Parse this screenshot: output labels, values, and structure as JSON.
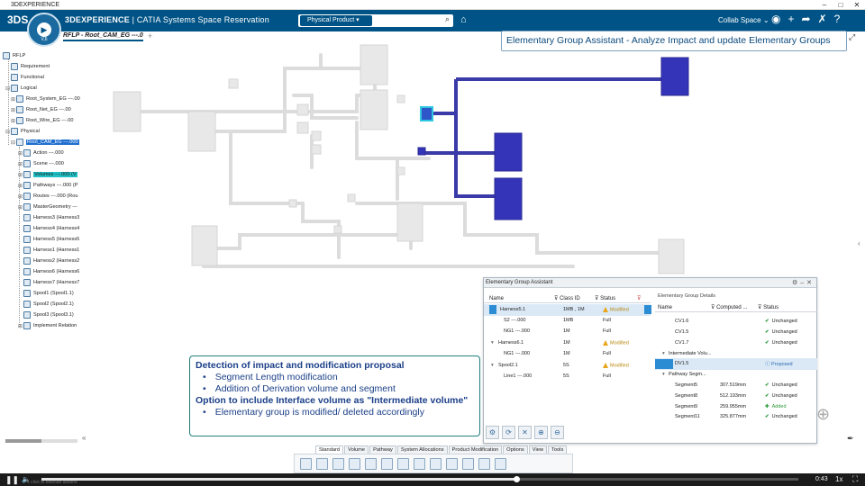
{
  "window": {
    "title": "3DEXPERIENCE"
  },
  "header": {
    "logo": "3DS",
    "brand_bold": "3DEXPERIENCE",
    "brand_rest": " | CATIA  Systems Space Reservation",
    "search_scope": "Physical Product",
    "collab_space": "Collab Space",
    "compass_version": "V,6"
  },
  "tab": {
    "label": "RFLP - Root_CAM_EG ---.0"
  },
  "banner": {
    "text": "Elementary Group Assistant - Analyze Impact and update Elementary Groups"
  },
  "tree": {
    "root": "RFLP",
    "requirement": "Requirement",
    "functional": "Functional",
    "logical": "Logical",
    "logical_items": [
      "Root_System_EG ---.00",
      "Root_Net_EG ---.00",
      "Root_Wire_EG ---.00"
    ],
    "physical": "Physical",
    "physical_root": "Root_CAM_EG ---.000",
    "children": [
      "Action ---.000",
      "Scene ---.000",
      "Volumes ---.000 (V",
      "Pathways ---.000 (P",
      "Routes ---.000 (Rou",
      "MasterGeometry ---"
    ],
    "harnesses": [
      "Harness3 (Harness3",
      "Harness4 (Harness4",
      "Harness5 (Harness5",
      "Harness1 (Harness1",
      "Harness2 (Harness2",
      "Harness6 (Harness6",
      "Harness7 (Harness7"
    ],
    "spools": [
      "Spool1 (Spool1.1)",
      "Spool2 (Spool2.1)",
      "Spool3 (Spool3.1)"
    ],
    "last": "Implement Relation"
  },
  "assistant": {
    "title": "Elementary Group Assistant",
    "left_headers": {
      "name": "Name",
      "class": "Class ID",
      "status": "Status"
    },
    "left_rows": [
      {
        "name": "Harness5.1",
        "class": "1MB , 1M",
        "status": "Modified",
        "warn": true
      },
      {
        "name": "S2 ---.000",
        "class": "1MB",
        "status": "Full",
        "warn": false
      },
      {
        "name": "NG1 ---.000",
        "class": "1M",
        "status": "Full",
        "warn": false
      },
      {
        "name": "Harness6.1",
        "class": "1M",
        "status": "Modified",
        "warn": true
      },
      {
        "name": "NG1 ---.000",
        "class": "1M",
        "status": "Full",
        "warn": false
      },
      {
        "name": "Spool2.1",
        "class": "5S",
        "status": "Modified",
        "warn": true
      },
      {
        "name": "Line1 ---.000",
        "class": "5S",
        "status": "Full",
        "warn": false
      }
    ],
    "details_title": "Elementary Group Details",
    "right_headers": {
      "name": "Name",
      "computed": "Computed ...",
      "status": "Status"
    },
    "right_rows": [
      {
        "name": "CV1.6",
        "computed": "",
        "status": "Unchanged"
      },
      {
        "name": "CV1.5",
        "computed": "",
        "status": "Unchanged"
      },
      {
        "name": "CV1.7",
        "computed": "",
        "status": "Unchanged"
      },
      {
        "name": "Intermediate Volu...",
        "computed": "",
        "status": ""
      },
      {
        "name": "DV1.5",
        "computed": "",
        "status": "Proposed"
      },
      {
        "name": "Pathway Segm...",
        "computed": "",
        "status": ""
      },
      {
        "name": "Segment5",
        "computed": "307.519mm",
        "status": "Unchanged"
      },
      {
        "name": "Segment8",
        "computed": "512.193mm",
        "status": "Unchanged"
      },
      {
        "name": "Segment9",
        "computed": "259.955mm",
        "status": "Added"
      },
      {
        "name": "Segment11",
        "computed": "325.877mm",
        "status": "Unchanged"
      }
    ]
  },
  "callout": {
    "heading1": "Detection of impact and modification proposal",
    "bullets1": [
      "Segment Length modification",
      "Addition of Derivation volume and segment"
    ],
    "heading2": "Option to include Interface volume as \"Intermediate volume\"",
    "bullets2": [
      "Elementary group is modified/ deleted accordingly"
    ]
  },
  "action_tabs": [
    "Standard",
    "Volume",
    "Pathway",
    "System Allocations",
    "Product Modification",
    "Options",
    "View",
    "Tools"
  ],
  "player": {
    "time": "0:43",
    "speed": "1x",
    "subtitle": "1 click to execute actions"
  },
  "colors": {
    "brand": "#005386",
    "selection": "#1f6fcf",
    "highlight": "#1ec0c5",
    "routed": "#3a3aa8"
  }
}
